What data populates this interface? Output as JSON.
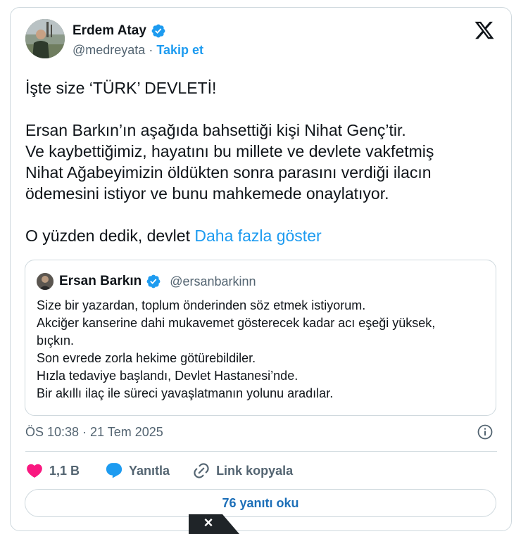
{
  "author": {
    "name": "Erdem Atay",
    "handle": "@medreyata",
    "separator": "·",
    "follow_label": "Takip et"
  },
  "tweet": {
    "lines": [
      "İşte size ‘TÜRK’ DEVLETİ!",
      "Ersan Barkın’ın aşağıda bahsettiği kişi Nihat Genç’tir.",
      "Ve kaybettiğimiz, hayatını bu millete ve devlete vakfetmiş",
      "Nihat Ağabeyimizin öldükten sonra parasını verdiği ilacın",
      "ödemesini istiyor ve bunu mahkemede onaylatıyor.",
      "O yüzden dedik, devlet"
    ],
    "show_more": "Daha fazla göster"
  },
  "quote": {
    "name": "Ersan Barkın",
    "handle": "@ersanbarkinn",
    "lines": [
      "Size bir yazardan, toplum önderinden söz etmek istiyorum.",
      "Akciğer kanserine dahi mukavemet gösterecek kadar acı eşeği yüksek,",
      "bıçkın.",
      "Son evrede zorla hekime götürebildiler.",
      "Hızla tedaviye başlandı, Devlet Hastanesi’nde.",
      "Bir akıllı ilaç ile süreci yavaşlatmanın yolunu aradılar."
    ]
  },
  "meta": {
    "timestamp": "ÖS 10:38 · 21 Tem 2025"
  },
  "actions": {
    "likes": "1,1 B",
    "reply": "Yanıtla",
    "copy_link": "Link kopyala"
  },
  "replies_button": "76 yanıtı oku",
  "close_label": "×",
  "colors": {
    "accent": "#1d9bf0",
    "like": "#f91880",
    "text": "#0f1419",
    "muted": "#536471",
    "border": "#cfd9de"
  }
}
